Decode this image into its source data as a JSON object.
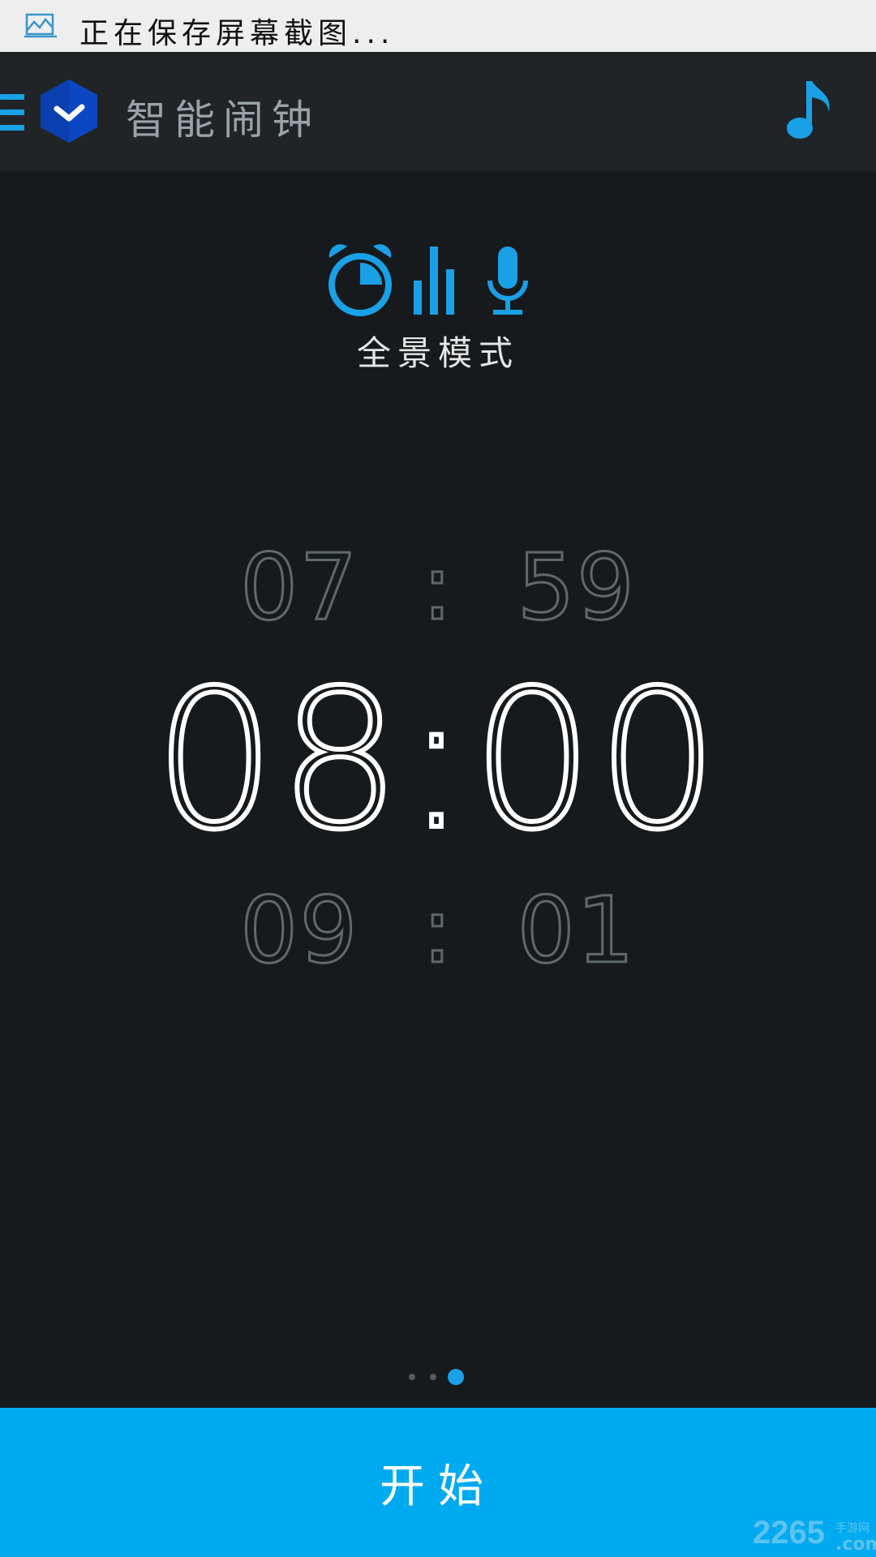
{
  "notification": {
    "icon": "screenshot-icon",
    "text": "正在保存屏幕截图..."
  },
  "app_bar": {
    "menu_icon": "menu-icon",
    "logo_icon": "hexagon-check-logo",
    "title": "智能闹钟",
    "music_icon": "music-note-icon"
  },
  "mode": {
    "icons": [
      "alarm-clock-icon",
      "bar-chart-icon",
      "microphone-icon"
    ],
    "label": "全景模式"
  },
  "time_picker": {
    "previous": {
      "hour": "07",
      "separator": ":",
      "minute": "59"
    },
    "current": {
      "hour": "08",
      "separator": ":",
      "minute": "00"
    },
    "next": {
      "hour": "09",
      "separator": ":",
      "minute": "01"
    }
  },
  "pager": {
    "count": 3,
    "active_index": 2
  },
  "start_button": {
    "label": "开始"
  },
  "watermark": {
    "text": "2265",
    "sub": "手游网",
    "domain": ".com"
  },
  "colors": {
    "accent": "#1aa0e6",
    "button": "#00aaf0",
    "background": "#171a1c",
    "app_bar": "#202427"
  }
}
